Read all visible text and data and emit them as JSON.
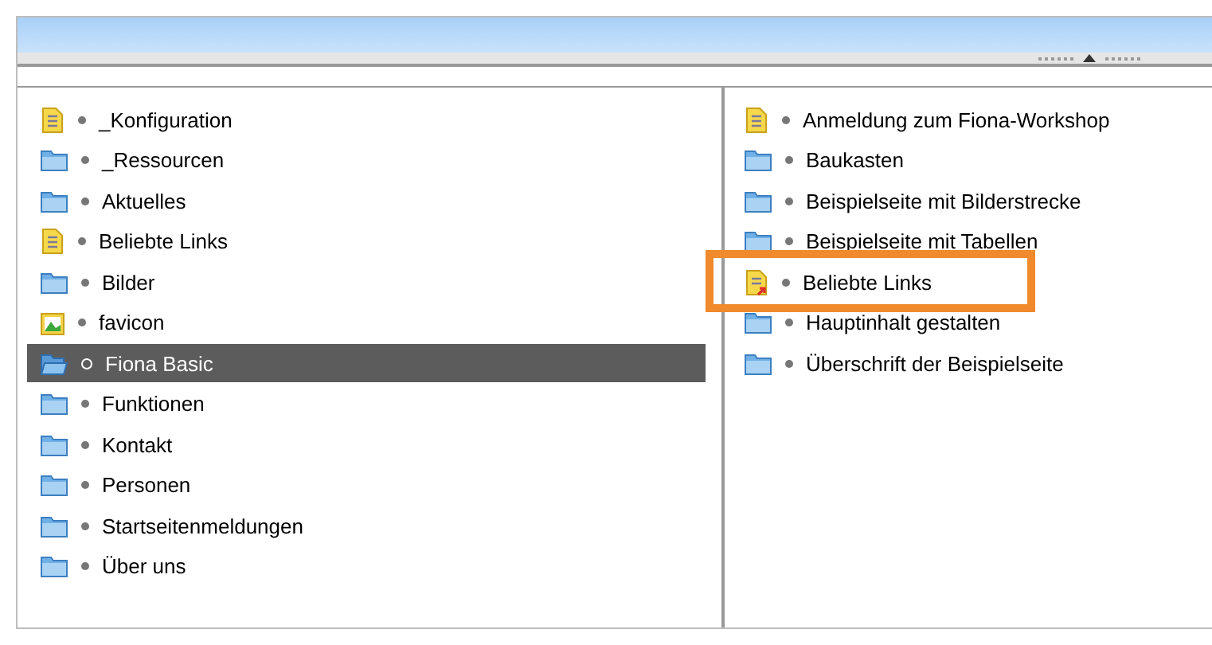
{
  "left_panel": {
    "items": [
      {
        "label": "_Konfiguration",
        "kind": "document",
        "selected": false
      },
      {
        "label": "_Ressourcen",
        "kind": "folder",
        "selected": false
      },
      {
        "label": "Aktuelles",
        "kind": "folder",
        "selected": false
      },
      {
        "label": "Beliebte Links",
        "kind": "document",
        "selected": false
      },
      {
        "label": "Bilder",
        "kind": "folder",
        "selected": false
      },
      {
        "label": "favicon",
        "kind": "image",
        "selected": false
      },
      {
        "label": "Fiona Basic",
        "kind": "folder",
        "selected": true
      },
      {
        "label": "Funktionen",
        "kind": "folder",
        "selected": false
      },
      {
        "label": "Kontakt",
        "kind": "folder",
        "selected": false
      },
      {
        "label": "Personen",
        "kind": "folder",
        "selected": false
      },
      {
        "label": "Startseitenmeldungen",
        "kind": "folder",
        "selected": false
      },
      {
        "label": "Über uns",
        "kind": "folder",
        "selected": false
      }
    ]
  },
  "right_panel": {
    "items": [
      {
        "label": "Anmeldung zum Fiona-Workshop",
        "kind": "document",
        "highlighted": false
      },
      {
        "label": "Baukasten",
        "kind": "folder",
        "highlighted": false
      },
      {
        "label": "Beispielseite mit Bilderstrecke",
        "kind": "folder",
        "highlighted": false
      },
      {
        "label": "Beispielseite mit Tabellen",
        "kind": "folder",
        "highlighted": false
      },
      {
        "label": "Beliebte Links",
        "kind": "link",
        "highlighted": true
      },
      {
        "label": "Hauptinhalt gestalten",
        "kind": "folder",
        "highlighted": false
      },
      {
        "label": "Überschrift der Beispielseite",
        "kind": "folder",
        "highlighted": false
      }
    ]
  }
}
